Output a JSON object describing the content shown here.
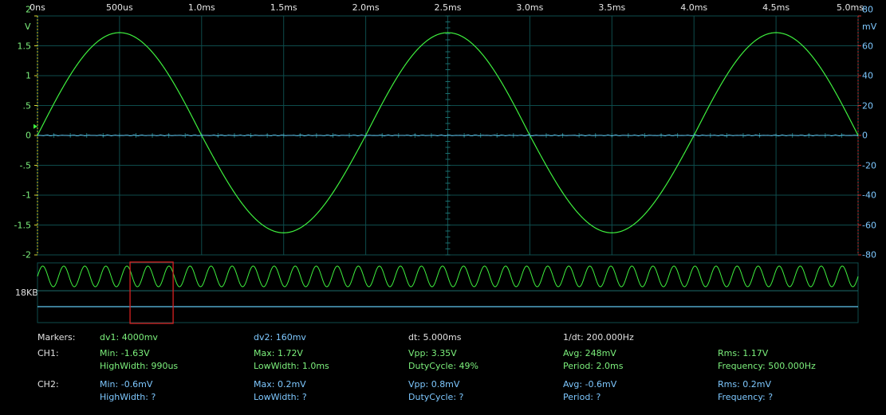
{
  "time_axis": {
    "labels": [
      "0ns",
      "500us",
      "1.0ms",
      "1.5ms",
      "2.0ms",
      "2.5ms",
      "3.0ms",
      "3.5ms",
      "4.0ms",
      "4.5ms",
      "5.0ms"
    ]
  },
  "left_axis": {
    "unit": "V",
    "labels": [
      "2",
      "1.5",
      "1",
      ".5",
      "0",
      "-.5",
      "-1",
      "-1.5",
      "-2"
    ]
  },
  "right_axis": {
    "unit": "mV",
    "labels": [
      "80",
      "60",
      "40",
      "20",
      "0",
      "-20",
      "-40",
      "-60",
      "-80"
    ]
  },
  "colors": {
    "ch1": "#3ef03e",
    "ch2": "#5fc6f0",
    "grid": "#0e4c4c",
    "left_axis_line": "#d6d634",
    "right_axis_line": "#c63434",
    "overview_window": "#d62020"
  },
  "chart_data": {
    "type": "line",
    "x_unit": "ms",
    "xlim": [
      0,
      5.0
    ],
    "ylim_left": [
      -2,
      2
    ],
    "ylim_right": [
      -80,
      80
    ],
    "series": [
      {
        "name": "CH1",
        "axis": "left",
        "shape": "sine",
        "frequency_hz": 500,
        "max": 1.72,
        "min": -1.63,
        "phase_zero_crossing_ms": 0.0
      },
      {
        "name": "CH2",
        "axis": "right",
        "shape": "flat",
        "value_mv": 0.0
      }
    ]
  },
  "overview": {
    "buffer_label": "18KB",
    "cycles_visible": 39
  },
  "stats": {
    "markers": {
      "label": "Markers:",
      "dv1": "dv1: 4000mv",
      "dv2": "dv2: 160mv",
      "dt": "dt: 5.000ms",
      "inv_dt": "1/dt: 200.000Hz"
    },
    "ch1": {
      "label": "CH1:",
      "min": "Min: -1.63V",
      "max": "Max: 1.72V",
      "vpp": "Vpp: 3.35V",
      "avg": "Avg: 248mV",
      "rms": "Rms: 1.17V",
      "high_width": "HighWidth: 990us",
      "low_width": "LowWidth: 1.0ms",
      "duty": "DutyCycle: 49%",
      "period": "Period: 2.0ms",
      "frequency": "Frequency: 500.000Hz"
    },
    "ch2": {
      "label": "CH2:",
      "min": "Min: -0.6mV",
      "max": "Max: 0.2mV",
      "vpp": "Vpp: 0.8mV",
      "avg": "Avg: -0.6mV",
      "rms": "Rms: 0.2mV",
      "high_width": "HighWidth: ?",
      "low_width": "LowWidth: ?",
      "duty": "DutyCycle: ?",
      "period": "Period: ?",
      "frequency": "Frequency: ?"
    }
  }
}
